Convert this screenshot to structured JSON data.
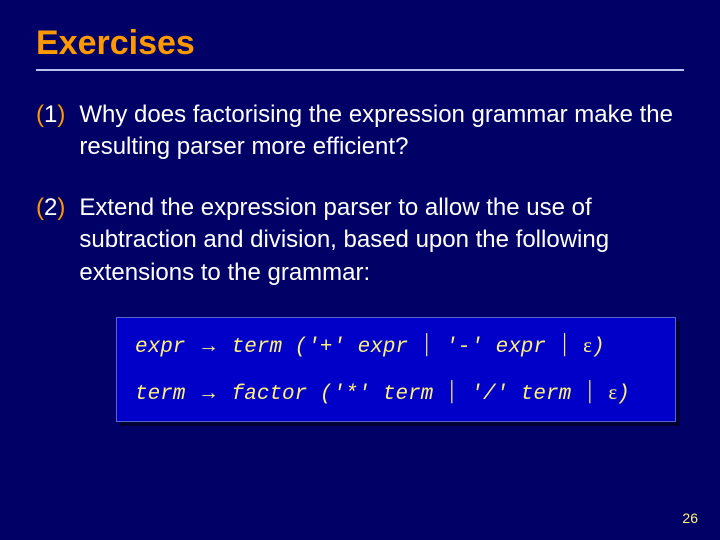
{
  "title": "Exercises",
  "items": [
    {
      "num_open": "(",
      "num_digit": "1",
      "num_close": ")",
      "text": "Why does factorising the expression grammar make the resulting parser more efficient?"
    },
    {
      "num_open": "(",
      "num_digit": "2",
      "num_close": ")",
      "text": "Extend the expression parser to allow the use of subtraction and division, based upon the following extensions to the grammar:"
    }
  ],
  "grammar": {
    "arrow": "→",
    "bar": "⏐",
    "eps": "ε",
    "rows": [
      {
        "lhs": "expr",
        "rhs1": "term ('+' expr",
        "rhs2": "'-' expr",
        "rhs3_close": ")"
      },
      {
        "lhs": "term",
        "rhs1": "factor ('*' term",
        "rhs2": "'/' term",
        "rhs3_close": ")"
      }
    ]
  },
  "page_number": "26"
}
